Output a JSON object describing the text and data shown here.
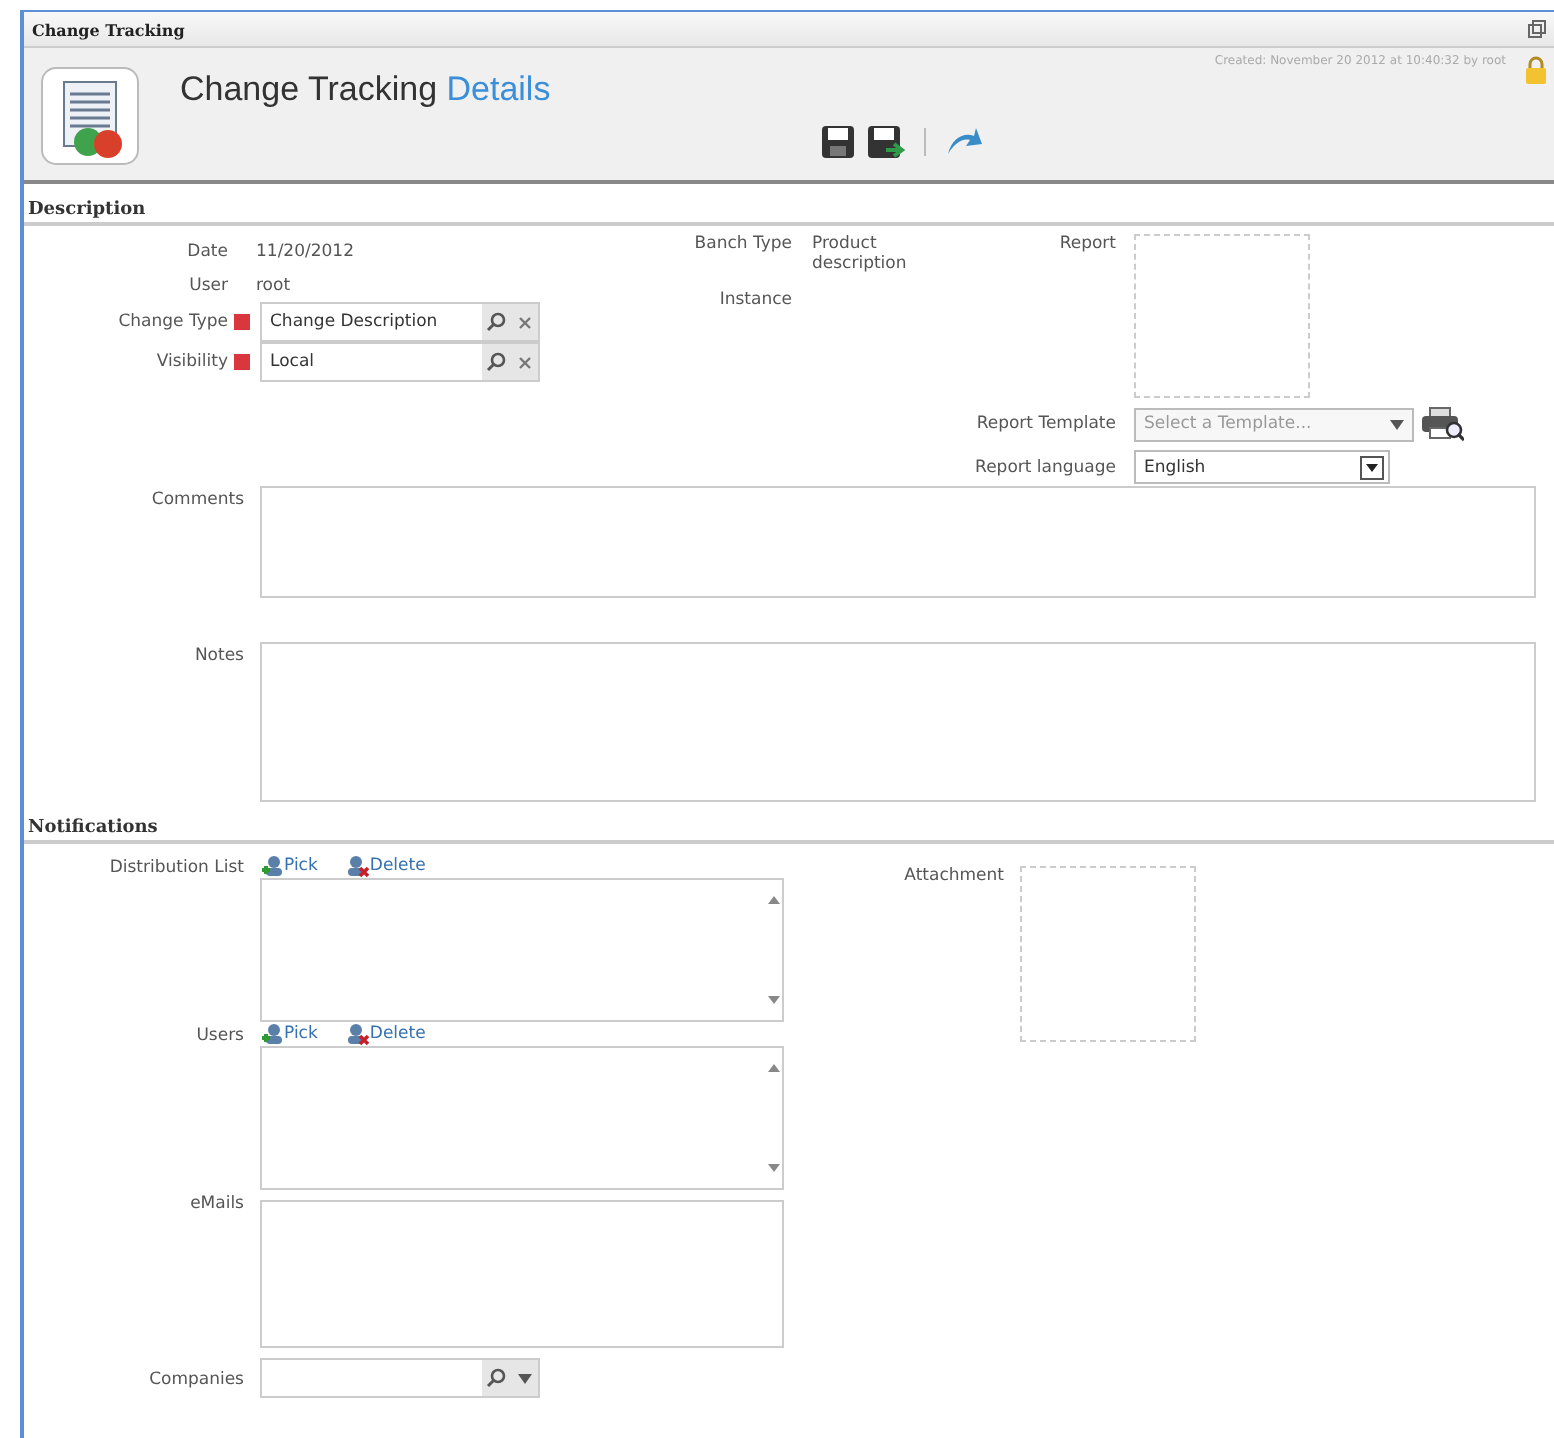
{
  "window": {
    "title": "Change Tracking"
  },
  "header": {
    "title": "Change Tracking",
    "subtitle": "Details",
    "created": "Created: November 20 2012 at 10:40:32 by root"
  },
  "toolbar": [
    {
      "kind": "save"
    },
    {
      "kind": "save-close"
    },
    {
      "kind": "separator"
    },
    {
      "kind": "undo"
    }
  ],
  "description": {
    "heading": "Description",
    "fields": [
      {
        "label": "Date",
        "kind": "text",
        "value": "11/20/2012"
      },
      {
        "label": "User",
        "kind": "text",
        "value": "root"
      },
      {
        "label": "Change Type",
        "kind": "lookup",
        "value": "Change Description",
        "required": true
      },
      {
        "label": "Visibility",
        "kind": "lookup",
        "value": "Local",
        "required": true
      }
    ],
    "middle": [
      {
        "label": "Banch Type",
        "value": "Product description"
      },
      {
        "label": "Instance"
      }
    ],
    "report": {
      "label": "Report"
    },
    "report_template": {
      "label": "Report Template",
      "placeholder": "Select a Template..."
    },
    "report_language": {
      "label": "Report language",
      "value": "English"
    },
    "comments": {
      "label": "Comments"
    },
    "notes": {
      "label": "Notes"
    }
  },
  "notifications": {
    "heading": "Notifications",
    "distribution_list": {
      "label": "Distribution List",
      "actions": [
        {
          "kind": "pick",
          "label": "Pick"
        },
        {
          "kind": "delete",
          "label": "Delete"
        }
      ]
    },
    "attachment": {
      "label": "Attachment"
    },
    "users": {
      "label": "Users",
      "actions": [
        {
          "kind": "pick",
          "label": "Pick"
        },
        {
          "kind": "delete",
          "label": "Delete"
        }
      ]
    },
    "emails": {
      "label": "eMails"
    },
    "companies": {
      "label": "Companies"
    }
  }
}
